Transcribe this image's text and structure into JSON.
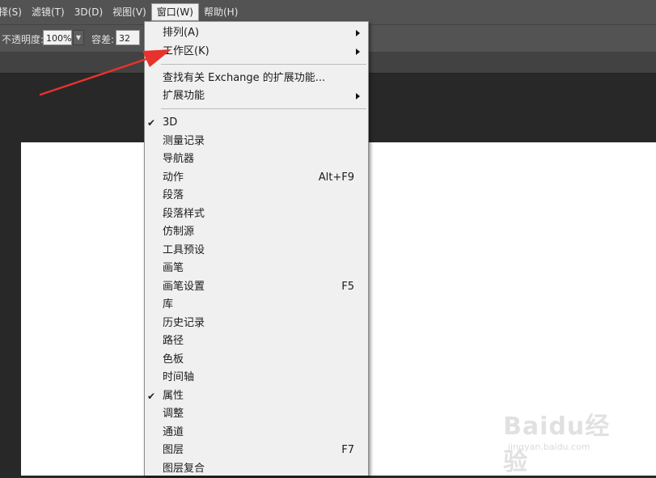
{
  "menubar": {
    "items": [
      {
        "label": "择(S)",
        "active": false
      },
      {
        "label": "滤镜(T)",
        "active": false
      },
      {
        "label": "3D(D)",
        "active": false
      },
      {
        "label": "视图(V)",
        "active": false
      },
      {
        "label": "窗口(W)",
        "active": true
      },
      {
        "label": "帮助(H)",
        "active": false
      }
    ]
  },
  "options": {
    "opacity_label": "不透明度:",
    "opacity_value": "100%",
    "tolerance_label": "容差:",
    "tolerance_value": "32"
  },
  "window_menu": {
    "group1": [
      {
        "label": "排列(A)",
        "submenu": true
      },
      {
        "label": "工作区(K)",
        "submenu": true
      }
    ],
    "group2": [
      {
        "label": "查找有关 Exchange 的扩展功能...",
        "submenu": false
      },
      {
        "label": "扩展功能",
        "submenu": true
      }
    ],
    "panels": [
      {
        "label": "3D",
        "checked": true,
        "shortcut": ""
      },
      {
        "label": "测量记录",
        "checked": false,
        "shortcut": ""
      },
      {
        "label": "导航器",
        "checked": false,
        "shortcut": ""
      },
      {
        "label": "动作",
        "checked": false,
        "shortcut": "Alt+F9"
      },
      {
        "label": "段落",
        "checked": false,
        "shortcut": ""
      },
      {
        "label": "段落样式",
        "checked": false,
        "shortcut": ""
      },
      {
        "label": "仿制源",
        "checked": false,
        "shortcut": ""
      },
      {
        "label": "工具预设",
        "checked": false,
        "shortcut": ""
      },
      {
        "label": "画笔",
        "checked": false,
        "shortcut": ""
      },
      {
        "label": "画笔设置",
        "checked": false,
        "shortcut": "F5"
      },
      {
        "label": "库",
        "checked": false,
        "shortcut": ""
      },
      {
        "label": "历史记录",
        "checked": false,
        "shortcut": ""
      },
      {
        "label": "路径",
        "checked": false,
        "shortcut": ""
      },
      {
        "label": "色板",
        "checked": false,
        "shortcut": ""
      },
      {
        "label": "时间轴",
        "checked": false,
        "shortcut": ""
      },
      {
        "label": "属性",
        "checked": true,
        "shortcut": ""
      },
      {
        "label": "调整",
        "checked": false,
        "shortcut": ""
      },
      {
        "label": "通道",
        "checked": false,
        "shortcut": ""
      },
      {
        "label": "图层",
        "checked": false,
        "shortcut": "F7"
      },
      {
        "label": "图层复合",
        "checked": false,
        "shortcut": ""
      }
    ]
  },
  "check_glyph": "✔",
  "dropdown_glyph": "▼",
  "watermark": {
    "brand": "Baidu经验",
    "site": "jingyan.baidu.com"
  },
  "colors": {
    "annotation_arrow": "#e8322d",
    "menu_bg": "#f0f0f0",
    "chrome_bg": "#535353",
    "workspace_bg": "#282828"
  }
}
